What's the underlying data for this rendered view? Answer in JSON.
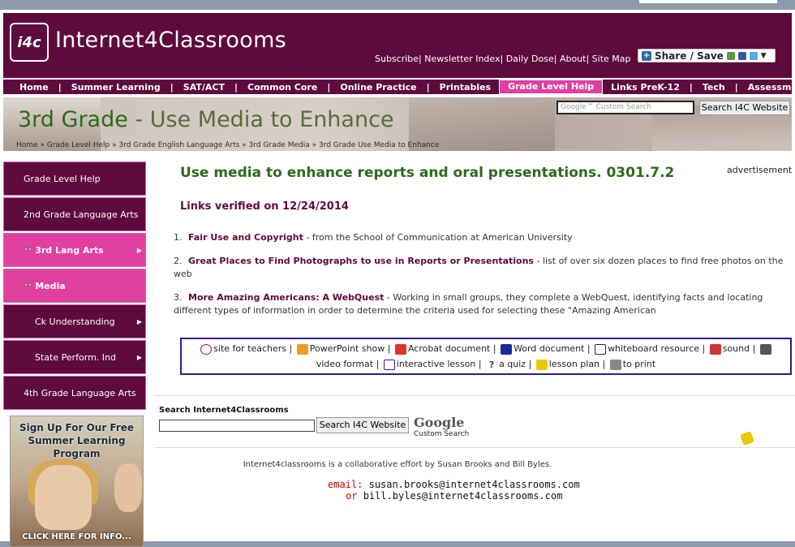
{
  "header": {
    "logo_badge": "i4c",
    "site_name": "Internet4Classrooms",
    "top_links": [
      "Subscribe",
      "Newsletter Index",
      "Daily Dose",
      "About",
      "Site Map"
    ],
    "share_label": "Share / Save"
  },
  "nav": {
    "items": [
      "Home",
      "Summer Learning",
      "SAT/ACT",
      "Common Core",
      "Online Practice",
      "Printables",
      "Grade Level Help",
      "Links PreK-12",
      "Tech",
      "Assessment"
    ]
  },
  "banner": {
    "title_grade": "3rd Grade",
    "title_rest": " - Use Media to Enhance",
    "breadcrumb": "Home » Grade Level Help » 3rd Grade English Language Arts » 3rd Grade Media » 3rd Grade Use Media to Enhance",
    "search_placeholder": "Google™ Custom Search",
    "search_button": "Search I4C Website"
  },
  "sidebar": {
    "items": [
      {
        "label": "Grade Level Help",
        "style": "dark"
      },
      {
        "label": "2nd Grade Language Arts",
        "style": "dark"
      },
      {
        "label": "3rd Lang Arts",
        "style": "pink"
      },
      {
        "label": "Media",
        "style": "pink"
      },
      {
        "label": "Ck Understanding",
        "style": "dark"
      },
      {
        "label": "State Perform. Ind",
        "style": "dark"
      },
      {
        "label": "4th Grade Language Arts",
        "style": "dark"
      }
    ],
    "promo_text": "Sign Up For Our Free Summer Learning Program",
    "promo_cta": "CLICK HERE FOR INFO..."
  },
  "main": {
    "advertisement": "advertisement",
    "heading": "Use media to enhance reports and oral presentations. 0301.7.2",
    "verified": "Links verified on 12/24/2014",
    "links": [
      {
        "num": "1.",
        "title": "Fair Use and Copyright",
        "desc": " - from the School of Communication at American University"
      },
      {
        "num": "2.",
        "title": "Great Places to Find Photographs to use in Reports or Presentations",
        "desc": " - list of over six dozen places to find free photos on the web"
      },
      {
        "num": "3.",
        "title": "More Amazing Americans: A WebQuest",
        "desc": " - Working in small groups, they complete a WebQuest, identifying facts and locating different types of information in order to determine the criteria used for selecting these \"Amazing American"
      }
    ],
    "legend": {
      "line1": [
        "site for teachers",
        "PowerPoint show",
        "Acrobat document",
        "Word document",
        "whiteboard resource",
        "sound"
      ],
      "line2": [
        "video format",
        "interactive lesson",
        "a quiz",
        "lesson plan",
        "to print"
      ]
    },
    "search_label": "Search Internet4Classrooms",
    "search_button": "Search I4C Website",
    "google_logo": "Google",
    "custom_search": "Custom Search",
    "footer_text": "Internet4classrooms is a collaborative effort by Susan Brooks and Bill Byles.",
    "email_label": "email:",
    "email1": "susan.brooks@internet4classrooms.com",
    "or_label": "or",
    "email2": "bill.byles@internet4classrooms.com"
  }
}
